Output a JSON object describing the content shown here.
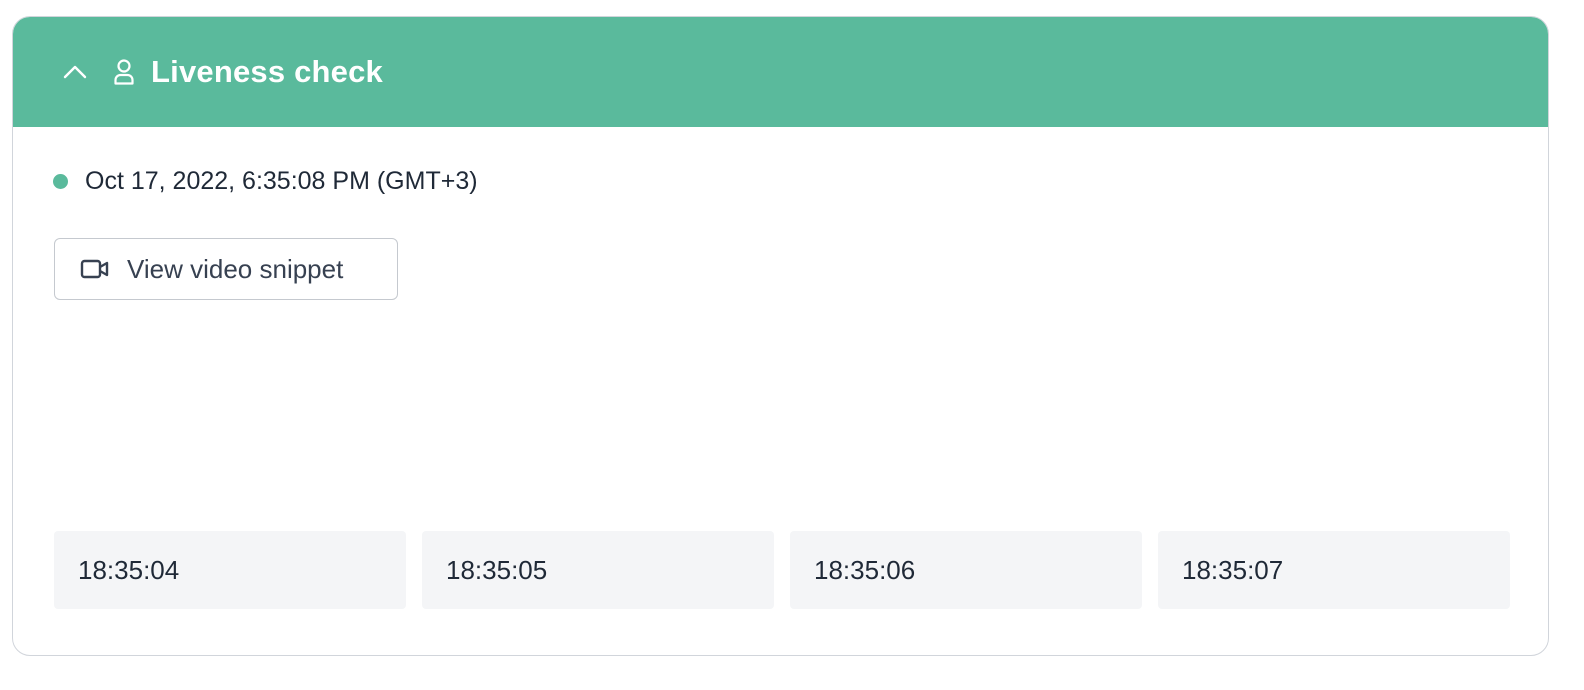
{
  "section": {
    "title": "Liveness check",
    "header_color": "#5aba9c",
    "collapse_icon": "chevron-up-icon",
    "section_icon": "person-icon"
  },
  "status": {
    "timestamp": "Oct 17, 2022, 6:35:08 PM (GMT+3)",
    "dot_color": "#5aba9c"
  },
  "video_button": {
    "label": "View video snippet",
    "icon": "video-camera-icon"
  },
  "frames": [
    {
      "time": "18:35:04"
    },
    {
      "time": "18:35:05"
    },
    {
      "time": "18:35:06"
    },
    {
      "time": "18:35:07"
    }
  ]
}
